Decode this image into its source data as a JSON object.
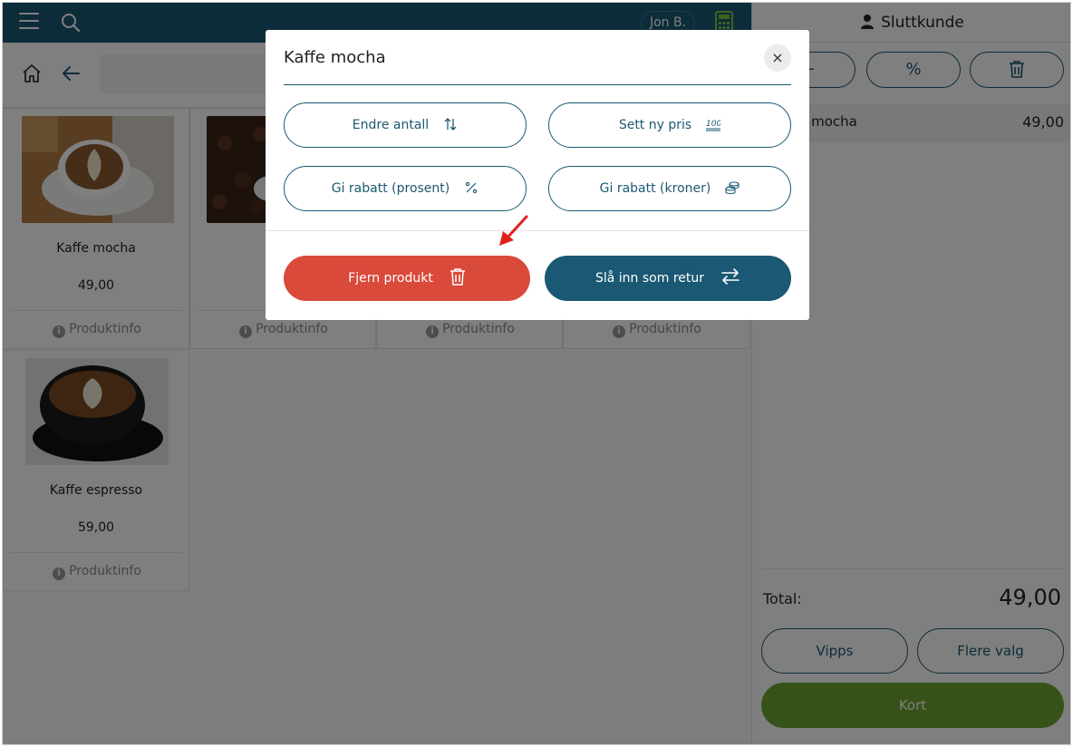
{
  "topbar": {
    "user": "Jon B."
  },
  "products": [
    {
      "name": "Kaffe mocha",
      "price": "49,00",
      "info": "Produktinfo"
    },
    {
      "name": "",
      "price": "",
      "info": "Produktinfo"
    },
    {
      "name": "",
      "price": "",
      "info": "Produktinfo"
    },
    {
      "name": "",
      "price": "",
      "info": "Produktinfo"
    },
    {
      "name": "Kaffe espresso",
      "price": "59,00",
      "info": "Produktinfo"
    }
  ],
  "cart": {
    "customer": "Sluttkunde",
    "qty_minus": "−",
    "discount_symbol": "%",
    "line_name": "Kaffe mocha",
    "line_price": "49,00",
    "total_label": "Total:",
    "total_value": "49,00",
    "vipps": "Vipps",
    "more": "Flere valg",
    "card": "Kort"
  },
  "modal": {
    "title": "Kaffe mocha",
    "close": "×",
    "change_qty": "Endre antall",
    "new_price": "Sett ny pris",
    "discount_pct": "Gi rabatt (prosent)",
    "discount_kr": "Gi rabatt (kroner)",
    "remove": "Fjern produkt",
    "return": "Slå inn som retur"
  },
  "colors": {
    "primary": "#1b5873",
    "danger": "#d94a3b",
    "success": "#6ea532",
    "annotation_arrow": "#e0201d"
  }
}
